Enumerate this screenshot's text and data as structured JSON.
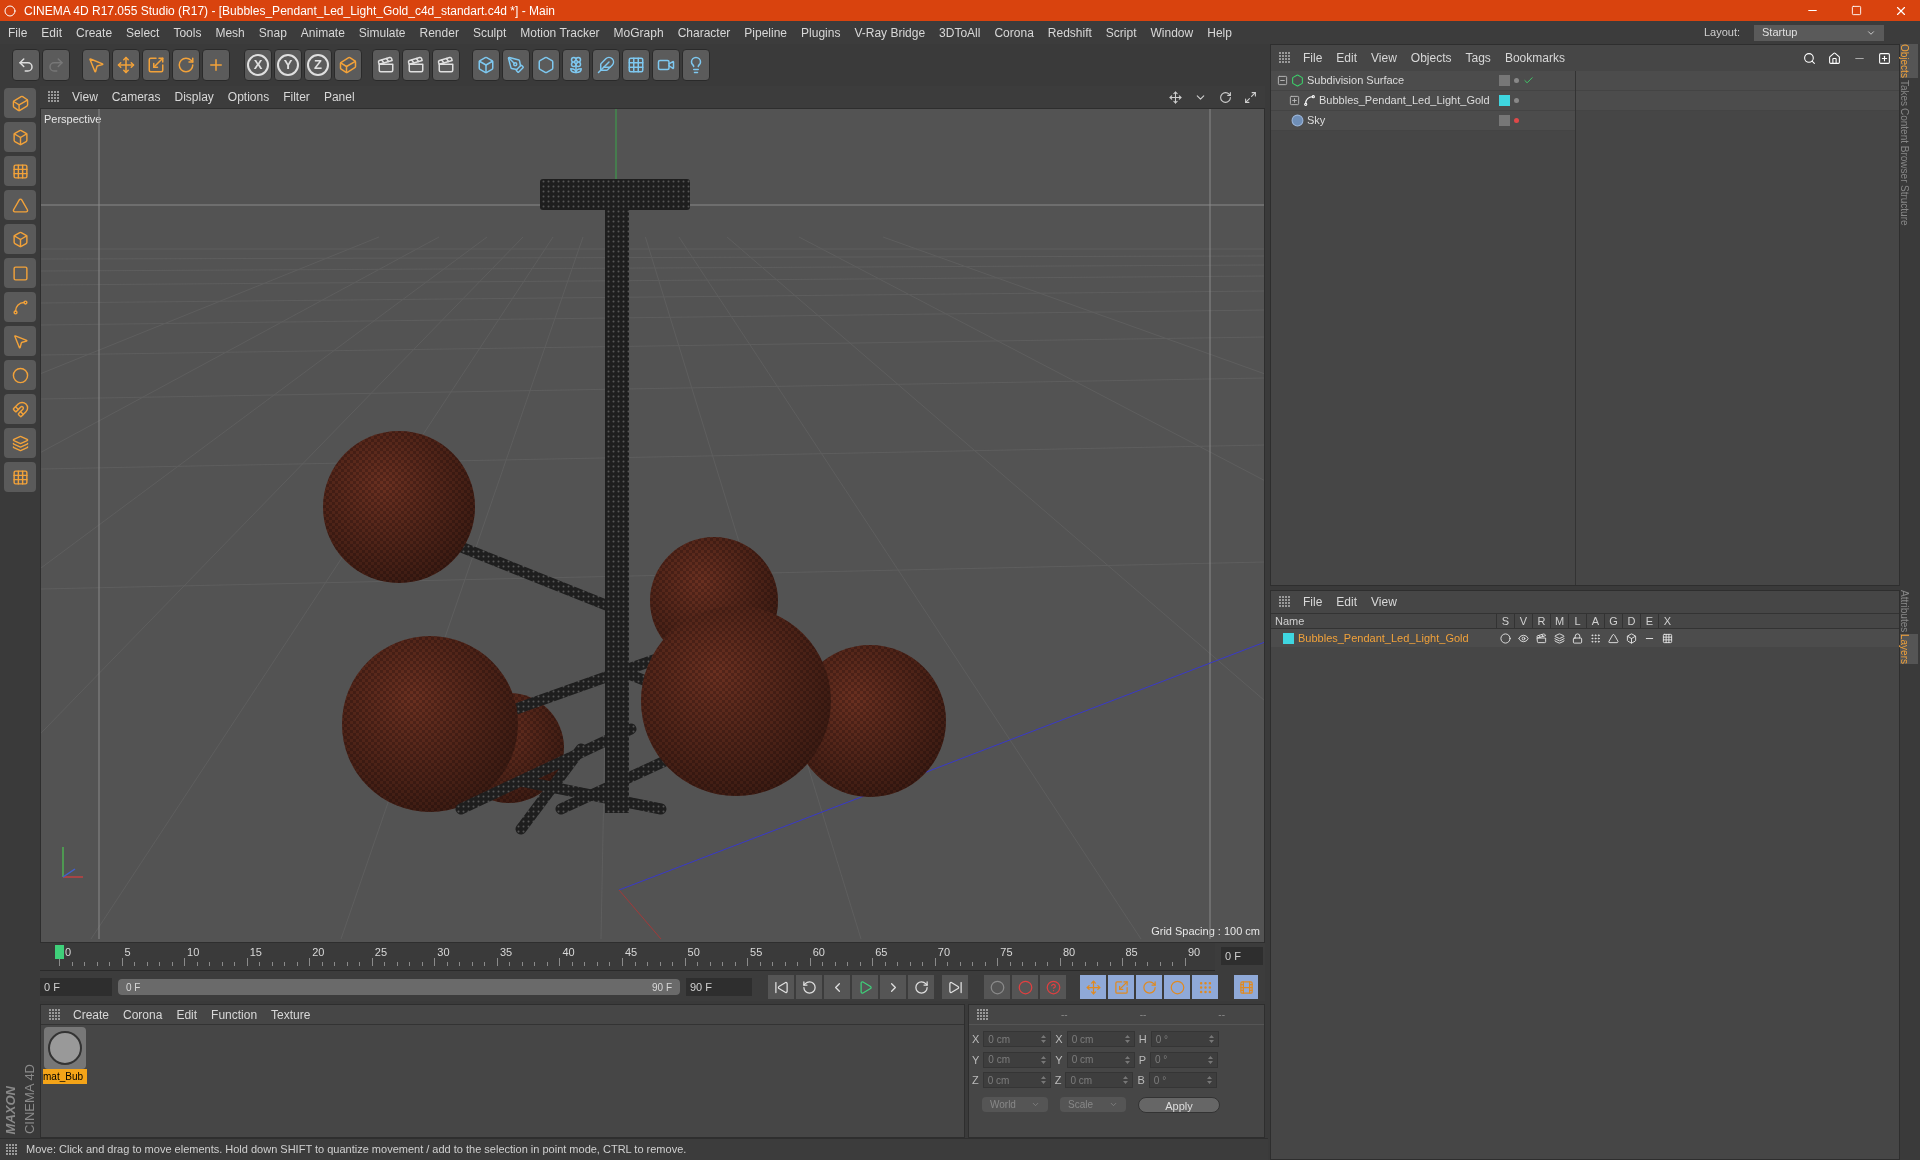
{
  "window": {
    "title": "CINEMA 4D R17.055 Studio (R17) - [Bubbles_Pendant_Led_Light_Gold_c4d_standart.c4d *] - Main"
  },
  "menu": [
    "File",
    "Edit",
    "Create",
    "Select",
    "Tools",
    "Mesh",
    "Snap",
    "Animate",
    "Simulate",
    "Render",
    "Sculpt",
    "Motion Tracker",
    "MoGraph",
    "Character",
    "Pipeline",
    "Plugins",
    "V-Ray Bridge",
    "3DToAll",
    "Corona",
    "Redshift",
    "Script",
    "Window",
    "Help"
  ],
  "layout": {
    "label": "Layout:",
    "value": "Startup"
  },
  "axis_buttons": [
    "X",
    "Y",
    "Z"
  ],
  "viewport": {
    "menu": [
      "View",
      "Cameras",
      "Display",
      "Options",
      "Filter",
      "Panel"
    ],
    "camera": "Perspective",
    "grid_spacing": "Grid Spacing : 100 cm"
  },
  "timeline": {
    "range_slider": {
      "level": 1
    },
    "ticks": [
      "0",
      "5",
      "10",
      "15",
      "20",
      "25",
      "30",
      "35",
      "40",
      "45",
      "50",
      "55",
      "60",
      "65",
      "70",
      "75",
      "80",
      "85",
      "90"
    ],
    "current": "0 F",
    "start": "0 F",
    "range_start": "0 F",
    "range_end": "90 F",
    "end": "90 F"
  },
  "material_panel": {
    "menu": [
      "Create",
      "Corona",
      "Edit",
      "Function",
      "Texture"
    ],
    "materials": [
      {
        "name": "mat_Bub",
        "selected": true
      }
    ]
  },
  "coordinates": {
    "headers": [
      "--",
      "--",
      "--"
    ],
    "rows": [
      {
        "pos_axis": "X",
        "position": "0 cm",
        "size_axis": "X",
        "size": "0 cm",
        "rot_axis": "H",
        "rotation": "0 °"
      },
      {
        "pos_axis": "Y",
        "position": "0 cm",
        "size_axis": "Y",
        "size": "0 cm",
        "rot_axis": "P",
        "rotation": "0 °"
      },
      {
        "pos_axis": "Z",
        "position": "0 cm",
        "size_axis": "Z",
        "size": "0 cm",
        "rot_axis": "B",
        "rotation": "0 °"
      }
    ],
    "mode": "World",
    "size_mode": "Scale",
    "apply": "Apply"
  },
  "logo": {
    "brand": "MAXON",
    "product": "CINEMA 4D"
  },
  "status_bar": "Move: Click and drag to move elements. Hold down SHIFT to quantize movement / add to the selection in point mode, CTRL to remove.",
  "objects_panel": {
    "menu": [
      "File",
      "Edit",
      "View",
      "Objects",
      "Tags",
      "Bookmarks"
    ],
    "objects": [
      {
        "name": "Subdivision Surface",
        "kind": "subdivision",
        "expanded": true,
        "enabled": true,
        "render_enabled": true,
        "children": [
          {
            "name": "Bubbles_Pendant_Led_Light_Gold",
            "kind": "null",
            "expanded": false,
            "color": "#3fd6e0",
            "render_enabled": true
          }
        ]
      },
      {
        "name": "Sky",
        "kind": "sky",
        "render_enabled": false
      }
    ]
  },
  "layers_panel": {
    "menu": [
      "File",
      "Edit",
      "View"
    ],
    "name_header": "Name",
    "columns": [
      "S",
      "V",
      "R",
      "M",
      "L",
      "A",
      "G",
      "D",
      "E",
      "X"
    ],
    "layers": [
      {
        "name": "Bubbles_Pendant_Led_Light_Gold",
        "color": "#3fd6e0"
      }
    ]
  },
  "side_tabs_top": [
    {
      "label": "Objects",
      "selected": true
    },
    {
      "label": "Takes",
      "selected": false
    },
    {
      "label": "Content Browser",
      "selected": false
    },
    {
      "label": "Structure",
      "selected": false
    }
  ],
  "side_tabs_bottom": [
    {
      "label": "Attributes",
      "selected": false
    },
    {
      "label": "Layers",
      "selected": true
    }
  ]
}
